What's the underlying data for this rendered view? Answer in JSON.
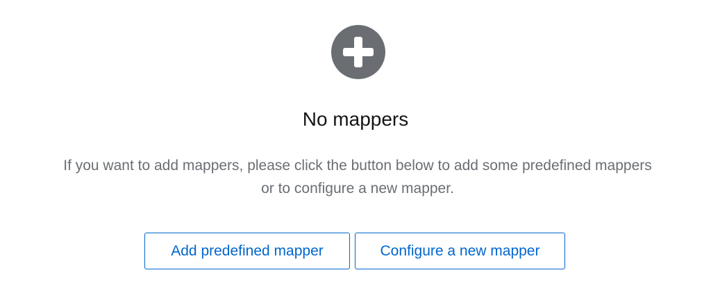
{
  "empty_state": {
    "icon": "plus-circle-icon",
    "icon_color": "#6a6e73",
    "title": "No mappers",
    "body": "If you want to add mappers, please click the button below to add some predefined mappers or to configure a new mapper.",
    "actions": {
      "add_predefined_label": "Add predefined mapper",
      "configure_new_label": "Configure a new mapper"
    },
    "accent_color": "#0066cc"
  }
}
